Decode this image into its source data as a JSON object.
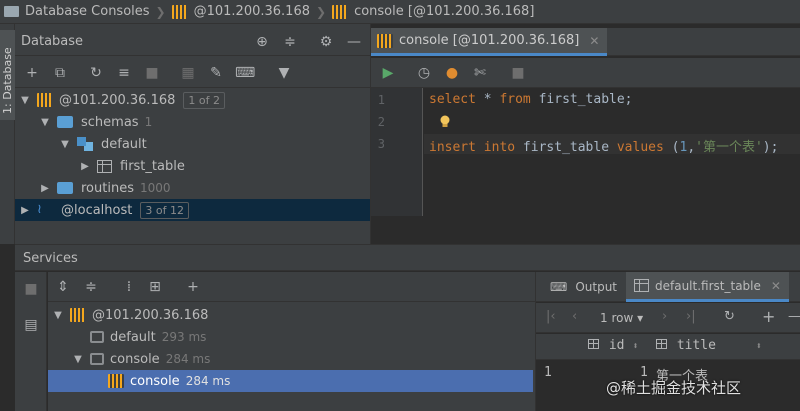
{
  "breadcrumb": {
    "items": [
      "Database Consoles",
      "@101.200.36.168",
      "console [@101.200.36.168]"
    ]
  },
  "left_strip": {
    "tab_label": "1: Database"
  },
  "database_panel": {
    "title": "Database",
    "tree": [
      {
        "label": "@101.200.36.168",
        "badge": "1 of 2"
      },
      {
        "label": "schemas",
        "count": "1"
      },
      {
        "label": "default"
      },
      {
        "label": "first_table"
      },
      {
        "label": "routines",
        "count": "1000"
      },
      {
        "label": "@localhost",
        "badge": "3 of 12"
      }
    ]
  },
  "editor": {
    "tab_label": "console [@101.200.36.168]",
    "line_numbers": [
      "1",
      "2",
      "3"
    ],
    "lines": {
      "l1": {
        "kw1": "select",
        "t1": " * ",
        "kw2": "from",
        "t2": " first_table;"
      },
      "l3": {
        "kw1": "insert",
        "t1": " ",
        "kw2": "into",
        "t2": " first_table ",
        "kw3": "values",
        "t3": " (",
        "num": "1",
        "t4": ",",
        "str": "'第一个表'",
        "t5": ");"
      }
    }
  },
  "services": {
    "title": "Services",
    "tree": [
      {
        "label": "@101.200.36.168"
      },
      {
        "label": "default",
        "time": "293 ms"
      },
      {
        "label": "console",
        "time": "284 ms"
      },
      {
        "label": "console",
        "time": "284 ms",
        "selected": true
      }
    ]
  },
  "output": {
    "tabs": [
      "Output",
      "default.first_table"
    ],
    "rows_selector": "1 row",
    "columns": [
      "id",
      "title"
    ],
    "rows": [
      {
        "row_num": "1",
        "id": "1",
        "title": "第一个表"
      }
    ]
  },
  "watermark": "@稀土掘金技术社区",
  "colors": {
    "background": "#2b2b2b",
    "panel": "#3c3f41",
    "accent": "#4a88c7",
    "selection": "#4b6eaf",
    "keyword": "#cc7832",
    "string": "#6a8759",
    "number": "#6897bb"
  }
}
